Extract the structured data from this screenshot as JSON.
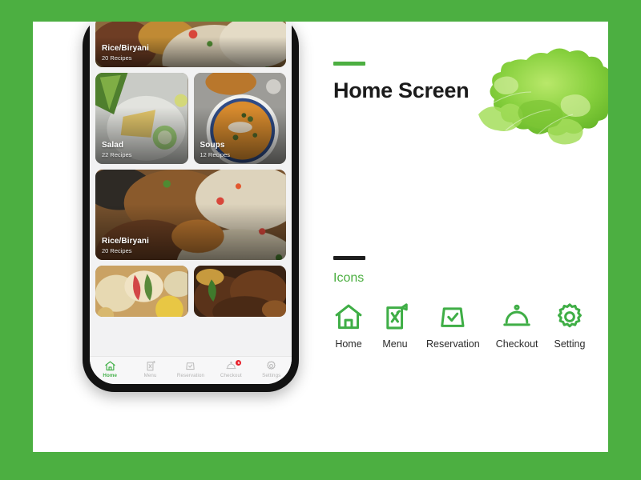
{
  "theme": {
    "background_green": "#4CAF41",
    "card_white": "#FFFFFF",
    "accent_green": "#4CAF41",
    "title_dark": "#1B1B1B",
    "badge_red": "#E8212B",
    "inactive_grey": "#B4B4B4"
  },
  "panel": {
    "title": "Home Screen",
    "title_rule_color": "#4CAF41",
    "icons_heading": "Icons",
    "icons_rule_color": "#1D1D1D",
    "hero_image_alt": "green-lettuce-leaf"
  },
  "icon_set": [
    {
      "label": "Home",
      "icon": "home-icon"
    },
    {
      "label": "Menu",
      "icon": "menu-card-icon"
    },
    {
      "label": "Reservation",
      "icon": "reservation-tent-icon"
    },
    {
      "label": "Checkout",
      "icon": "cloche-icon"
    },
    {
      "label": "Setting",
      "icon": "gear-icon"
    }
  ],
  "phone": {
    "feed": [
      {
        "layout": "wide-top",
        "title": "Rice/Biryani",
        "subtitle": "20 Recipes",
        "image_alt": "biryani-with-chicken"
      },
      {
        "layout": "pair",
        "items": [
          {
            "title": "Salad",
            "subtitle": "22 Recipes",
            "image_alt": "salad-plate-with-cucumber"
          },
          {
            "title": "Soups",
            "subtitle": "12 Recipes",
            "image_alt": "bowl-of-pumpkin-soup"
          }
        ]
      },
      {
        "layout": "wide",
        "title": "Rice/Biryani",
        "subtitle": "20 Recipes",
        "image_alt": "chicken-biryani-closeup"
      },
      {
        "layout": "pair-partial",
        "items": [
          {
            "title": "",
            "subtitle": "",
            "image_alt": "pastry-and-fruit-platter"
          },
          {
            "title": "",
            "subtitle": "",
            "image_alt": "fried-chicken-curry"
          }
        ]
      }
    ],
    "tabbar": [
      {
        "label": "Home",
        "icon": "home-icon",
        "active": true,
        "badge": ""
      },
      {
        "label": "Menu",
        "icon": "menu-card-icon",
        "active": false,
        "badge": ""
      },
      {
        "label": "Reservation",
        "icon": "reservation-tent-icon",
        "active": false,
        "badge": ""
      },
      {
        "label": "Checkout",
        "icon": "cloche-icon",
        "active": false,
        "badge": "6"
      },
      {
        "label": "Settings",
        "icon": "gear-icon",
        "active": false,
        "badge": ""
      }
    ]
  }
}
